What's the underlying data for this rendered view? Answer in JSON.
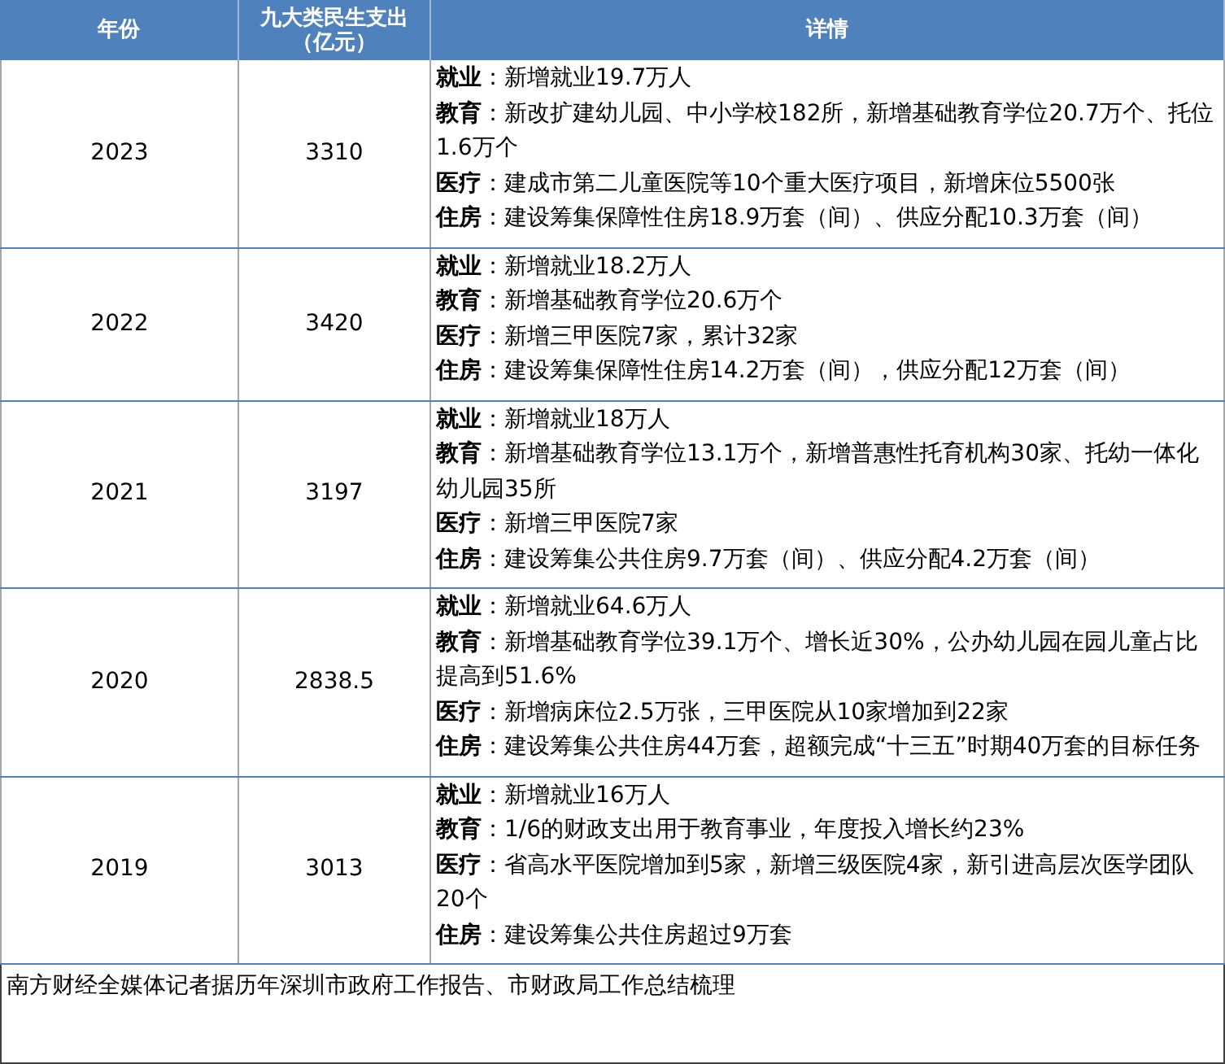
{
  "table": {
    "columns": [
      {
        "lines": [
          "年份"
        ]
      },
      {
        "lines": [
          "九大类民生支出",
          "（亿元）"
        ]
      },
      {
        "lines": [
          "详情"
        ]
      }
    ],
    "rows": [
      {
        "year": "2023",
        "amount": "3310",
        "details": [
          {
            "label": "就业",
            "text": "：新增就业19.7万人"
          },
          {
            "label": "教育",
            "text": "：新改扩建幼儿园、中小学校182所，新增基础教育学位20.7万个、托位1.6万个"
          },
          {
            "label": "医疗",
            "text": "：建成市第二儿童医院等10个重大医疗项目，新增床位5500张"
          },
          {
            "label": "住房",
            "text": "：建设筹集保障性住房18.9万套（间）、供应分配10.3万套（间）"
          }
        ]
      },
      {
        "year": "2022",
        "amount": "3420",
        "details": [
          {
            "label": "就业",
            "text": "：新增就业18.2万人"
          },
          {
            "label": "教育",
            "text": "：新增基础教育学位20.6万个"
          },
          {
            "label": "医疗",
            "text": "：新增三甲医院7家，累计32家"
          },
          {
            "label": "住房",
            "text": "：建设筹集保障性住房14.2万套（间），供应分配12万套（间）"
          }
        ]
      },
      {
        "year": "2021",
        "amount": "3197",
        "details": [
          {
            "label": "就业",
            "text": "：新增就业18万人"
          },
          {
            "label": "教育",
            "text": "：新增基础教育学位13.1万个，新增普惠性托育机构30家、托幼一体化幼儿园35所"
          },
          {
            "label": "医疗",
            "text": "：新增三甲医院7家"
          },
          {
            "label": "住房",
            "text": "：建设筹集公共住房9.7万套（间）、供应分配4.2万套（间）"
          }
        ]
      },
      {
        "year": "2020",
        "amount": "2838.5",
        "details": [
          {
            "label": "就业",
            "text": "：新增就业64.6万人"
          },
          {
            "label": "教育",
            "text": "：新增基础教育学位39.1万个、增长近30%，公办幼儿园在园儿童占比提高到51.6%"
          },
          {
            "label": "医疗",
            "text": "：新增病床位2.5万张，三甲医院从10家增加到22家"
          },
          {
            "label": "住房",
            "text": "：建设筹集公共住房44万套，超额完成“十三五”时期40万套的目标任务"
          }
        ]
      },
      {
        "year": "2019",
        "amount": "3013",
        "details": [
          {
            "label": "就业",
            "text": "：新增就业16万人"
          },
          {
            "label": "教育",
            "text": "：1/6的财政支出用于教育事业，年度投入增长约23%"
          },
          {
            "label": "医疗",
            "text": "：省高水平医院增加到5家，新增三级医院4家，新引进高层次医学团队20个"
          },
          {
            "label": "住房",
            "text": "：建设筹集公共住房超过9万套"
          }
        ]
      }
    ],
    "footnote": "南方财经全媒体记者据历年深圳市政府工作报告、市财政局工作总结梳理"
  }
}
